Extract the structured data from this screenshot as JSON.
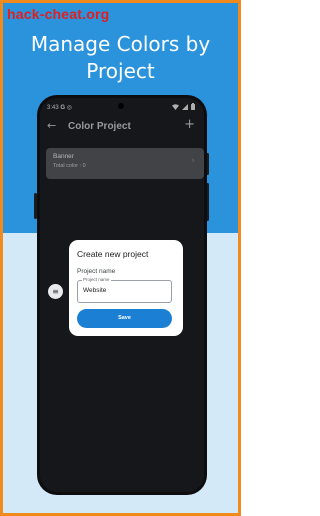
{
  "headline": {
    "line1": "Manage Colors by",
    "line2": "Project"
  },
  "watermark": "hack-cheat.org",
  "status_bar": {
    "time": "3:43",
    "carrier_icon": "G",
    "icons": [
      "wifi-icon",
      "signal-icon",
      "battery-icon"
    ]
  },
  "appbar": {
    "back_icon": "←",
    "title": "Color Project",
    "add_icon": "+"
  },
  "project_card": {
    "name": "Banner",
    "subtitle": "Total color : 0",
    "chevron": "›"
  },
  "dialog": {
    "title": "Create new project",
    "field_label": "Project name",
    "input_floating_label": "Project name",
    "input_value": "Website",
    "save_label": "Save"
  },
  "fab_icon": "≡",
  "colors": {
    "frame_border": "#f08a1c",
    "bg_top": "#2b93dc",
    "bg_bottom": "#d3e9f7",
    "accent_button": "#1b80d4",
    "screen_bg": "#1d1f23",
    "card_bg": "#585a5e"
  }
}
